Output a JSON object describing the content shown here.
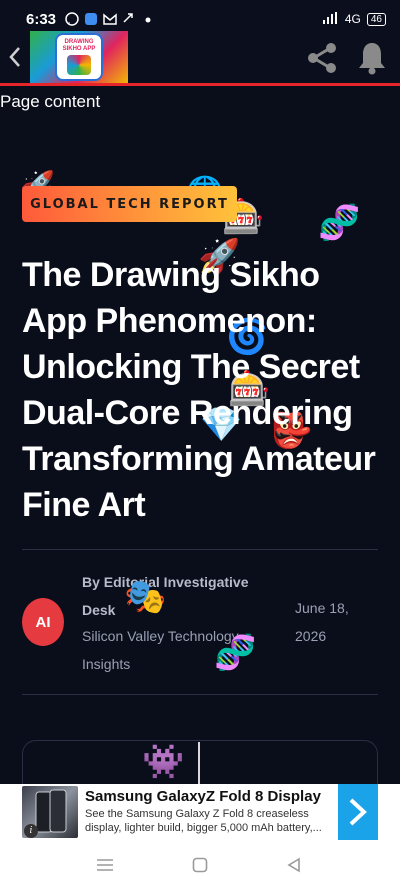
{
  "status_bar": {
    "time": "6:33",
    "icons": [
      "whatsapp-icon",
      "app-icon",
      "gmail-icon",
      "link-icon",
      "dot-icon"
    ],
    "network": "4G",
    "battery": "46"
  },
  "app_bar": {
    "logo_text": "DRAWING SIKHO APP",
    "colors": {
      "accent_line": "#e5252a"
    }
  },
  "page": {
    "content_label": "Page content"
  },
  "article": {
    "badge": "GLOBAL TECH REPORT",
    "headline": "The Drawing Sikho App Phenomenon: Unlocking The Secret Dual-Core Rendering Transforming Amateur Fine Art",
    "author_initials": "AI",
    "byline": "By Editorial Investigative Desk",
    "organization": "Silicon Valley Technology Insights",
    "date": "June 18, 2026"
  },
  "ad": {
    "title": "Samsung GalaxyZ Fold 8 Display",
    "description": "See the Samsung Galaxy Z Fold 8 creaseless display, lighter build, bigger 5,000 mAh battery,..."
  },
  "nav_bar": {
    "icons": [
      "menu-icon",
      "home-icon",
      "back-icon"
    ]
  }
}
